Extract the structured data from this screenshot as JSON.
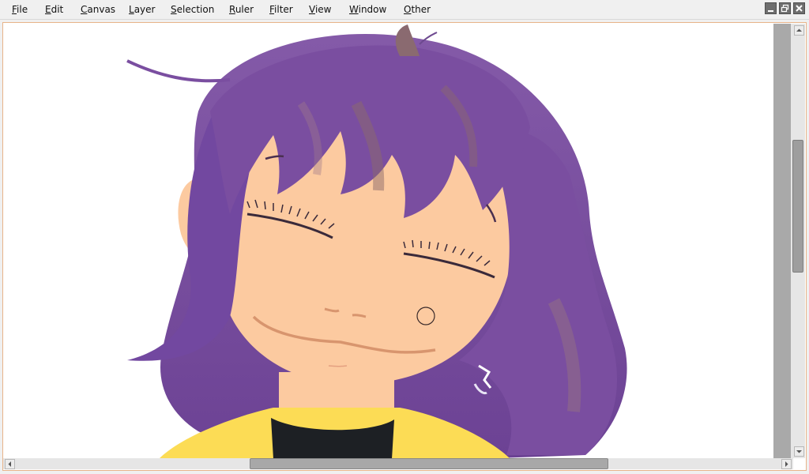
{
  "menubar": {
    "items": [
      {
        "first": "F",
        "rest": "ile"
      },
      {
        "first": "E",
        "rest": "dit"
      },
      {
        "first": "C",
        "rest": "anvas"
      },
      {
        "first": "L",
        "rest": "ayer"
      },
      {
        "first": "S",
        "rest": "election"
      },
      {
        "first": "R",
        "rest": "uler"
      },
      {
        "first": "F",
        "rest": "ilter"
      },
      {
        "first": "V",
        "rest": "iew"
      },
      {
        "first": "W",
        "rest": "indow"
      },
      {
        "first": "O",
        "rest": "ther"
      }
    ]
  },
  "window_controls": {
    "icons": [
      "minimize-icon",
      "restore-icon",
      "close-icon"
    ]
  },
  "colors": {
    "hair": "#7a4ea0",
    "hair_dark": "#5e3a86",
    "skin": "#fccaa0",
    "shirt": "#fcdc55",
    "collar": "#1d2024",
    "frame_border": "#e8b48a"
  }
}
